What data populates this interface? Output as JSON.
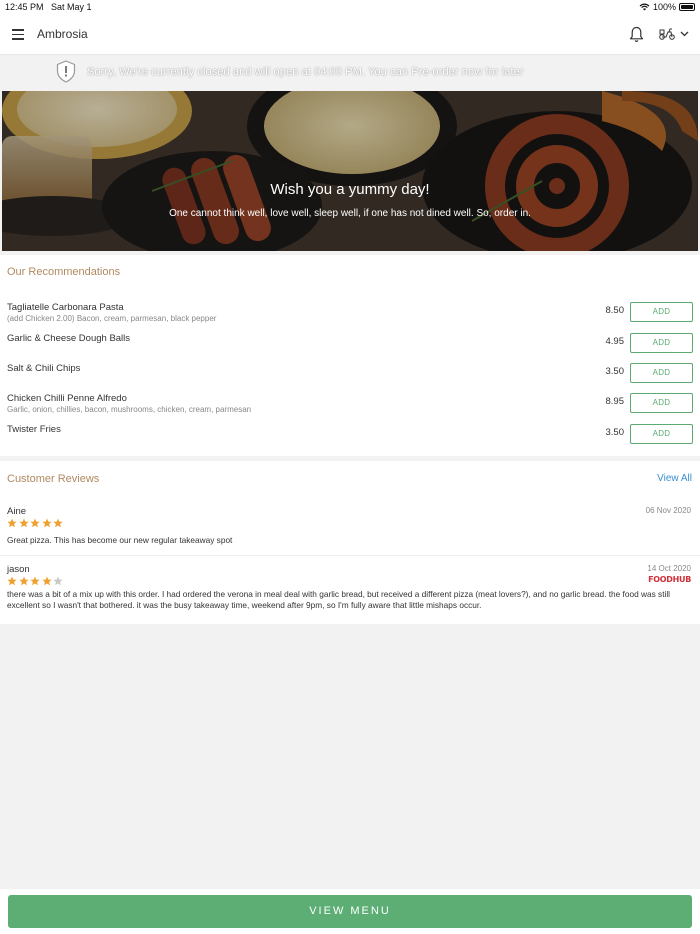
{
  "status_bar": {
    "time": "12:45 PM",
    "date": "Sat May 1",
    "battery": "100%"
  },
  "header": {
    "title": "Ambrosia"
  },
  "notice": {
    "message": "Sorry, We're currently closed and will open at 04:00 PM. You can Pre-order now for later"
  },
  "hero": {
    "title": "Wish you a yummy day!",
    "subtitle": "One cannot think well, love well, sleep well, if one has not dined well. So, order in."
  },
  "recommendations": {
    "title": "Our Recommendations",
    "add_label": "ADD",
    "items": [
      {
        "name": "Tagliatelle Carbonara Pasta",
        "description": "(add Chicken 2.00) Bacon, cream, parmesan, black pepper",
        "price": "8.50"
      },
      {
        "name": "Garlic & Cheese Dough Balls",
        "description": "",
        "price": "4.95"
      },
      {
        "name": "Salt & Chili Chips",
        "description": "",
        "price": "3.50"
      },
      {
        "name": "Chicken Chilli Penne Alfredo",
        "description": "Garlic, onion, chillies, bacon, mushrooms, chicken, cream, parmesan",
        "price": "8.95"
      },
      {
        "name": "Twister Fries",
        "description": "",
        "price": "3.50"
      }
    ]
  },
  "reviews": {
    "title": "Customer Reviews",
    "view_all_label": "View All",
    "items": [
      {
        "author": "Aine",
        "date": "06 Nov 2020",
        "rating": 5,
        "text": "Great pizza. This has become our new regular takeaway spot",
        "source": ""
      },
      {
        "author": "jason",
        "date": "14 Oct 2020",
        "rating": 4,
        "text": "there was a bit of a mix up with this order. I had ordered the verona in meal deal with garlic bread, but received a different pizza (meat lovers?), and no garlic bread. the food was still excellent so I wasn't that bothered.  it was the busy takeaway time, weekend after 9pm, so I'm fully aware that little mishaps occur.",
        "source": "FOODHUB"
      }
    ]
  },
  "footer": {
    "view_menu_label": "VIEW MENU"
  },
  "colors": {
    "accent_green": "#5cae74",
    "section_title": "#b08a60",
    "link_blue": "#3a8fd0",
    "star_orange": "#f0a030",
    "star_empty": "#c8c8c8",
    "foodhub_red": "#d0303a"
  }
}
